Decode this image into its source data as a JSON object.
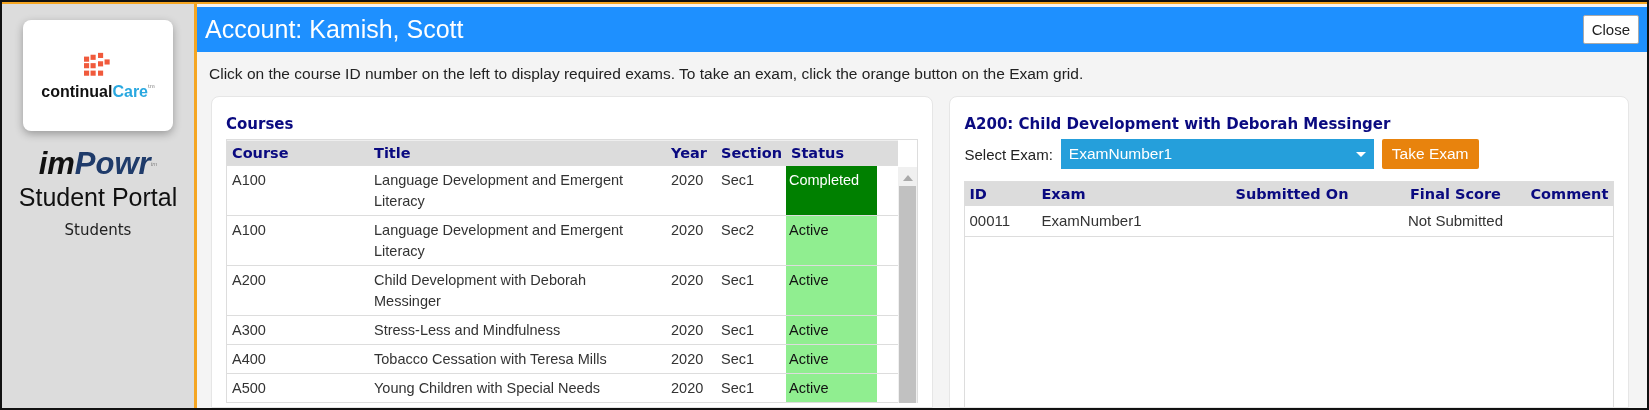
{
  "sidebar": {
    "logo": {
      "text_dark": "continual",
      "text_accent": "Care",
      "tm": "tm"
    },
    "brand": {
      "part_dark": "im",
      "part_accent": "Powr",
      "tm": "tm"
    },
    "portal_title": "Student Portal",
    "role": "Students"
  },
  "header": {
    "title": "Account: Kamish, Scott",
    "close_button": "Close"
  },
  "instructions": "Click on the course ID number on the left to display required exams. To take an exam, click the orange button on the Exam grid.",
  "courses": {
    "title": "Courses",
    "columns": [
      "Course",
      "Title",
      "Year",
      "Section",
      "Status"
    ],
    "rows": [
      {
        "course": "A100",
        "title": "Language Development and Emergent Literacy",
        "year": "2020",
        "section": "Sec1",
        "status": "Completed",
        "color": "#008000"
      },
      {
        "course": "A100",
        "title": "Language Development and Emergent Literacy",
        "year": "2020",
        "section": "Sec2",
        "status": "Active",
        "color": "#90ee90"
      },
      {
        "course": "A200",
        "title": "Child Development with Deborah Messinger",
        "year": "2020",
        "section": "Sec1",
        "status": "Active",
        "color": "#90ee90"
      },
      {
        "course": "A300",
        "title": "Stress-Less and Mindfulness",
        "year": "2020",
        "section": "Sec1",
        "status": "Active",
        "color": "#90ee90"
      },
      {
        "course": "A400",
        "title": "Tobacco Cessation with Teresa Mills",
        "year": "2020",
        "section": "Sec1",
        "status": "Active",
        "color": "#90ee90"
      },
      {
        "course": "A500",
        "title": "Young Children with Special Needs",
        "year": "2020",
        "section": "Sec1",
        "status": "Active",
        "color": "#90ee90"
      }
    ]
  },
  "exams": {
    "title": "A200: Child Development with Deborah Messinger",
    "select_label": "Select Exam:",
    "select_value": "ExamNumber1",
    "take_button": "Take Exam",
    "columns": [
      "ID",
      "Exam",
      "Submitted On",
      "Final Score",
      "Comment"
    ],
    "rows": [
      {
        "id": "00011",
        "exam": "ExamNumber1",
        "final_score": "Not Submitted"
      }
    ]
  }
}
